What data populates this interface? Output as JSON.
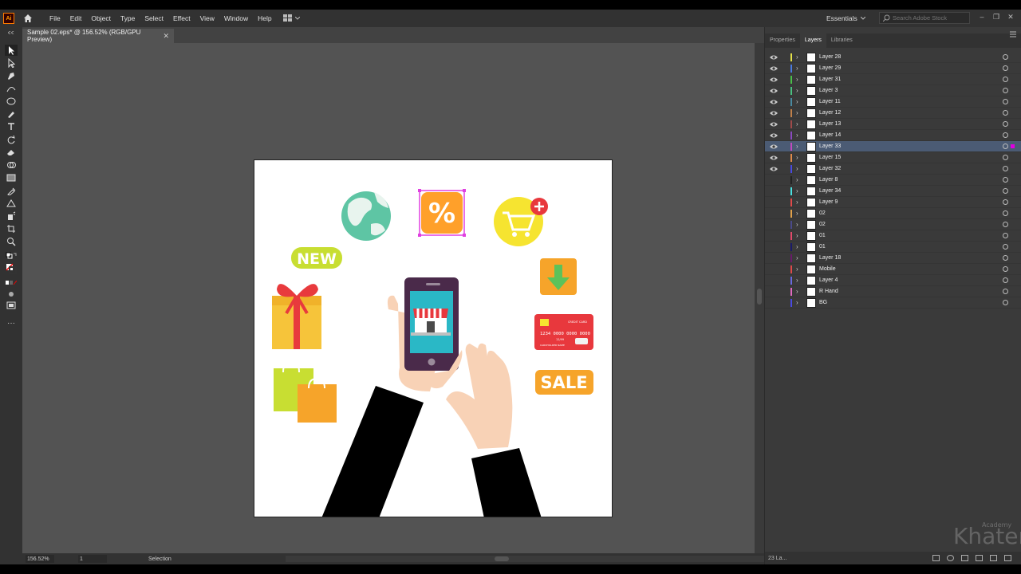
{
  "app": {
    "logo_text": "Ai",
    "accent": "#ff9a00"
  },
  "menu": {
    "items": [
      "File",
      "Edit",
      "Object",
      "Type",
      "Select",
      "Effect",
      "View",
      "Window",
      "Help"
    ]
  },
  "workspace": {
    "label": "Essentials"
  },
  "search": {
    "placeholder": "Search Adobe Stock"
  },
  "document": {
    "tab_title": "Sample 02.eps* @ 156.52% (RGB/GPU Preview)"
  },
  "status": {
    "zoom": "156.52%",
    "page": "1",
    "tool": "Selection"
  },
  "panel": {
    "tabs": [
      "Properties",
      "Layers",
      "Libraries"
    ],
    "active_tab": "Layers",
    "layer_count_text": "23 La...",
    "layers": [
      {
        "name": "Layer 28",
        "color": "#e6e24a",
        "visible": true
      },
      {
        "name": "Layer 29",
        "color": "#4a7ae0",
        "visible": true
      },
      {
        "name": "Layer 31",
        "color": "#4ac04a",
        "visible": true
      },
      {
        "name": "Layer 3",
        "color": "#4ac080",
        "visible": true
      },
      {
        "name": "Layer 11",
        "color": "#4a8aa0",
        "visible": true
      },
      {
        "name": "Layer 12",
        "color": "#c0804a",
        "visible": true
      },
      {
        "name": "Layer 13",
        "color": "#a04a4a",
        "visible": true
      },
      {
        "name": "Layer 14",
        "color": "#8a4ac0",
        "visible": true
      },
      {
        "name": "Layer 33",
        "color": "#c04ac0",
        "visible": true,
        "selected": true
      },
      {
        "name": "Layer 15",
        "color": "#e08a4a",
        "visible": true
      },
      {
        "name": "Layer 32",
        "color": "#4a4ae0",
        "visible": true
      },
      {
        "name": "Layer 8",
        "color": "#222222",
        "visible": false
      },
      {
        "name": "Layer 34",
        "color": "#4ae0e0",
        "visible": false
      },
      {
        "name": "Layer 9",
        "color": "#e04a4a",
        "visible": false
      },
      {
        "name": "02",
        "color": "#e0a04a",
        "visible": false
      },
      {
        "name": "02",
        "color": "#4a4a8a",
        "visible": false
      },
      {
        "name": "01",
        "color": "#e04a6a",
        "visible": false
      },
      {
        "name": "01",
        "color": "#1a1a6a",
        "visible": false
      },
      {
        "name": "Layer 18",
        "color": "#6a1a6a",
        "visible": false
      },
      {
        "name": "Mobile",
        "color": "#e04a4a",
        "visible": false
      },
      {
        "name": "Layer 4",
        "color": "#6a6ae0",
        "visible": false
      },
      {
        "name": "R Hand",
        "color": "#e06ac0",
        "visible": false
      },
      {
        "name": "BG",
        "color": "#4a4ae0",
        "visible": false
      }
    ]
  },
  "artwork": {
    "badge_new": "NEW",
    "badge_sale": "SALE",
    "percent_symbol": "%",
    "card_number": "1234 0000 0000 0000",
    "card_label": "CREDIT CARD",
    "card_expiry": "12/99",
    "card_holder": "CARDHOLDER NAME"
  },
  "watermark": {
    "brand": "Khater",
    "sub": "Academy"
  }
}
